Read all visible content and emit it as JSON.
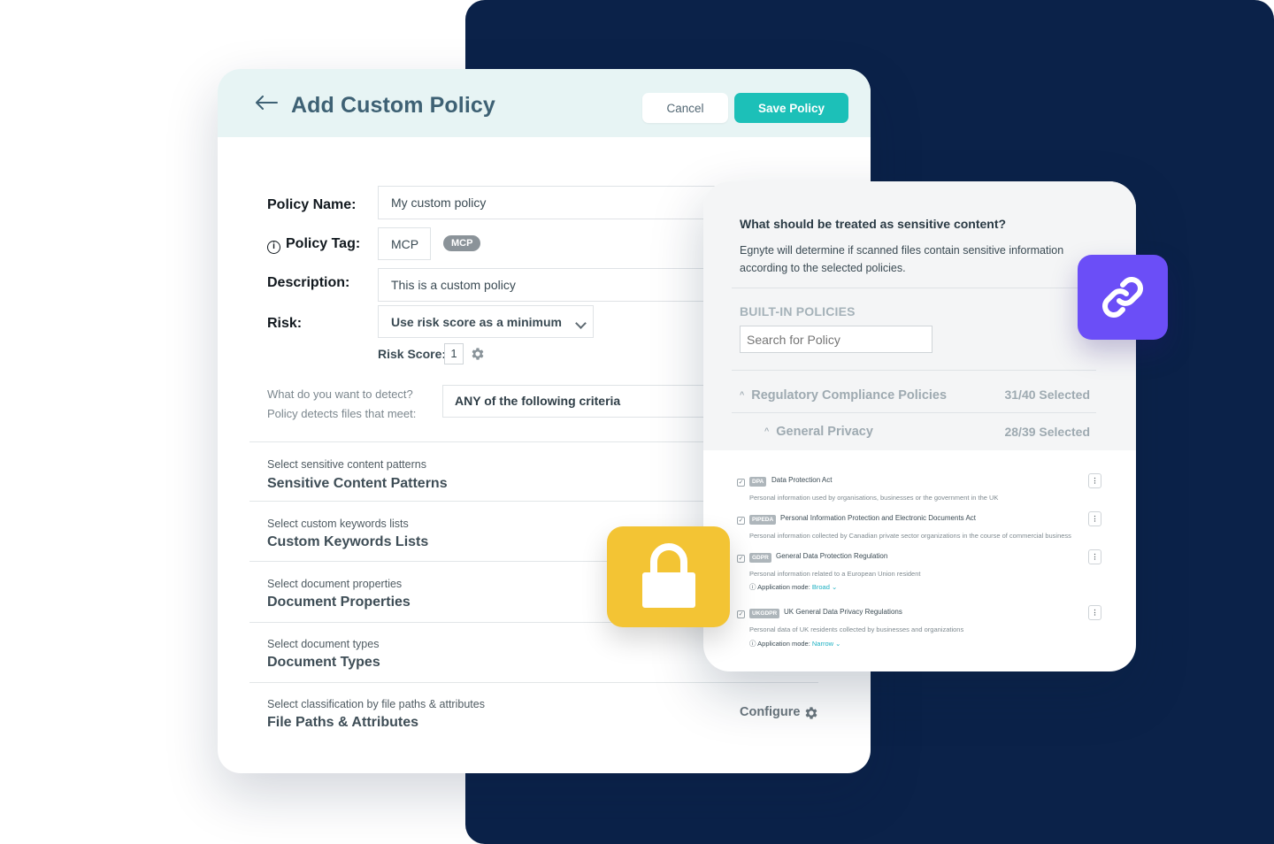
{
  "header": {
    "title": "Add Custom Policy",
    "cancel_label": "Cancel",
    "save_label": "Save Policy"
  },
  "form": {
    "policy_name_label": "Policy Name:",
    "policy_name_value": "My custom policy",
    "policy_tag_label": "Policy Tag:",
    "policy_tag_value": "MCP",
    "policy_tag_pill": "MCP",
    "description_label": "Description:",
    "description_value": "This is a custom policy",
    "risk_label": "Risk:",
    "risk_value": "Use risk score as a minimum",
    "risk_score_label": "Risk Score:",
    "risk_score_value": "1",
    "detect_question": "What do you want to detect?",
    "detect_sub": "Policy detects files that meet:",
    "criteria_value": "ANY of the following criteria"
  },
  "sections": [
    {
      "sub": "Select sensitive content patterns",
      "title": "Sensitive Content Patterns"
    },
    {
      "sub": "Select custom keywords lists",
      "title": "Custom Keywords Lists"
    },
    {
      "sub": "Select document properties",
      "title": "Document Properties"
    },
    {
      "sub": "Select document types",
      "title": "Document Types"
    },
    {
      "sub": "Select classification by file paths & attributes",
      "title": "File Paths & Attributes"
    }
  ],
  "configure_label": "Configure",
  "side": {
    "question": "What should be treated as sensitive content?",
    "description": "Egnyte will determine if scanned files contain sensitive information according to the selected policies.",
    "builtin_heading": "BUILT-IN POLICIES",
    "search_placeholder": "Search for Policy",
    "group1": {
      "name": "Regulatory Compliance Policies",
      "count": "31/40 Selected"
    },
    "group2": {
      "name": "General Privacy",
      "count": "28/39 Selected"
    },
    "policies": [
      {
        "badge": "DPA",
        "name": "Data Protection Act",
        "desc": "Personal information used by organisations, businesses or the government in the UK",
        "mode_label": "",
        "mode_value": ""
      },
      {
        "badge": "PIPEDA",
        "name": "Personal Information Protection and Electronic Documents Act",
        "desc": "Personal information collected by Canadian private sector organizations in the course of commercial business",
        "mode_label": "",
        "mode_value": ""
      },
      {
        "badge": "GDPR",
        "name": "General Data Protection Regulation",
        "desc": "Personal information related to a European Union resident",
        "mode_label": "Application mode:",
        "mode_value": "Broad"
      },
      {
        "badge": "UKGDPR",
        "name": "UK General Data Privacy Regulations",
        "desc": "Personal data of UK residents collected by businesses and organizations",
        "mode_label": "Application mode:",
        "mode_value": "Narrow"
      }
    ]
  },
  "colors": {
    "navy": "#0b2249",
    "teal": "#1cc0b8",
    "header_tint": "#e7f4f4",
    "lock_yellow": "#f3c434",
    "link_purple": "#6b4ef7"
  },
  "icons": {
    "back": "arrow-left-icon",
    "info": "info-icon",
    "gear": "gear-icon",
    "lock": "lock-icon",
    "link": "link-icon"
  }
}
